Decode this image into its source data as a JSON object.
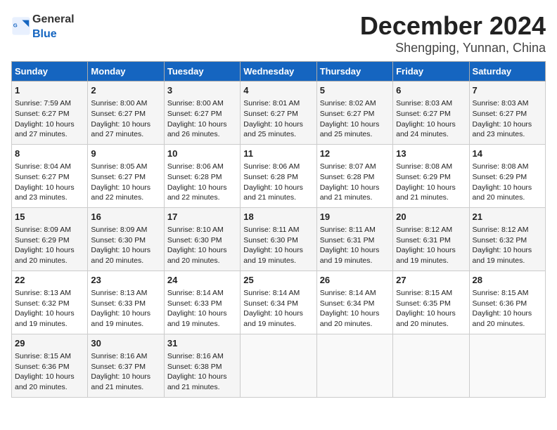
{
  "logo": {
    "general": "General",
    "blue": "Blue"
  },
  "title": "December 2024",
  "subtitle": "Shengping, Yunnan, China",
  "days_header": [
    "Sunday",
    "Monday",
    "Tuesday",
    "Wednesday",
    "Thursday",
    "Friday",
    "Saturday"
  ],
  "weeks": [
    [
      {
        "day": "1",
        "info": "Sunrise: 7:59 AM\nSunset: 6:27 PM\nDaylight: 10 hours\nand 27 minutes."
      },
      {
        "day": "2",
        "info": "Sunrise: 8:00 AM\nSunset: 6:27 PM\nDaylight: 10 hours\nand 27 minutes."
      },
      {
        "day": "3",
        "info": "Sunrise: 8:00 AM\nSunset: 6:27 PM\nDaylight: 10 hours\nand 26 minutes."
      },
      {
        "day": "4",
        "info": "Sunrise: 8:01 AM\nSunset: 6:27 PM\nDaylight: 10 hours\nand 25 minutes."
      },
      {
        "day": "5",
        "info": "Sunrise: 8:02 AM\nSunset: 6:27 PM\nDaylight: 10 hours\nand 25 minutes."
      },
      {
        "day": "6",
        "info": "Sunrise: 8:03 AM\nSunset: 6:27 PM\nDaylight: 10 hours\nand 24 minutes."
      },
      {
        "day": "7",
        "info": "Sunrise: 8:03 AM\nSunset: 6:27 PM\nDaylight: 10 hours\nand 23 minutes."
      }
    ],
    [
      {
        "day": "8",
        "info": "Sunrise: 8:04 AM\nSunset: 6:27 PM\nDaylight: 10 hours\nand 23 minutes."
      },
      {
        "day": "9",
        "info": "Sunrise: 8:05 AM\nSunset: 6:27 PM\nDaylight: 10 hours\nand 22 minutes."
      },
      {
        "day": "10",
        "info": "Sunrise: 8:06 AM\nSunset: 6:28 PM\nDaylight: 10 hours\nand 22 minutes."
      },
      {
        "day": "11",
        "info": "Sunrise: 8:06 AM\nSunset: 6:28 PM\nDaylight: 10 hours\nand 21 minutes."
      },
      {
        "day": "12",
        "info": "Sunrise: 8:07 AM\nSunset: 6:28 PM\nDaylight: 10 hours\nand 21 minutes."
      },
      {
        "day": "13",
        "info": "Sunrise: 8:08 AM\nSunset: 6:29 PM\nDaylight: 10 hours\nand 21 minutes."
      },
      {
        "day": "14",
        "info": "Sunrise: 8:08 AM\nSunset: 6:29 PM\nDaylight: 10 hours\nand 20 minutes."
      }
    ],
    [
      {
        "day": "15",
        "info": "Sunrise: 8:09 AM\nSunset: 6:29 PM\nDaylight: 10 hours\nand 20 minutes."
      },
      {
        "day": "16",
        "info": "Sunrise: 8:09 AM\nSunset: 6:30 PM\nDaylight: 10 hours\nand 20 minutes."
      },
      {
        "day": "17",
        "info": "Sunrise: 8:10 AM\nSunset: 6:30 PM\nDaylight: 10 hours\nand 20 minutes."
      },
      {
        "day": "18",
        "info": "Sunrise: 8:11 AM\nSunset: 6:30 PM\nDaylight: 10 hours\nand 19 minutes."
      },
      {
        "day": "19",
        "info": "Sunrise: 8:11 AM\nSunset: 6:31 PM\nDaylight: 10 hours\nand 19 minutes."
      },
      {
        "day": "20",
        "info": "Sunrise: 8:12 AM\nSunset: 6:31 PM\nDaylight: 10 hours\nand 19 minutes."
      },
      {
        "day": "21",
        "info": "Sunrise: 8:12 AM\nSunset: 6:32 PM\nDaylight: 10 hours\nand 19 minutes."
      }
    ],
    [
      {
        "day": "22",
        "info": "Sunrise: 8:13 AM\nSunset: 6:32 PM\nDaylight: 10 hours\nand 19 minutes."
      },
      {
        "day": "23",
        "info": "Sunrise: 8:13 AM\nSunset: 6:33 PM\nDaylight: 10 hours\nand 19 minutes."
      },
      {
        "day": "24",
        "info": "Sunrise: 8:14 AM\nSunset: 6:33 PM\nDaylight: 10 hours\nand 19 minutes."
      },
      {
        "day": "25",
        "info": "Sunrise: 8:14 AM\nSunset: 6:34 PM\nDaylight: 10 hours\nand 19 minutes."
      },
      {
        "day": "26",
        "info": "Sunrise: 8:14 AM\nSunset: 6:34 PM\nDaylight: 10 hours\nand 20 minutes."
      },
      {
        "day": "27",
        "info": "Sunrise: 8:15 AM\nSunset: 6:35 PM\nDaylight: 10 hours\nand 20 minutes."
      },
      {
        "day": "28",
        "info": "Sunrise: 8:15 AM\nSunset: 6:36 PM\nDaylight: 10 hours\nand 20 minutes."
      }
    ],
    [
      {
        "day": "29",
        "info": "Sunrise: 8:15 AM\nSunset: 6:36 PM\nDaylight: 10 hours\nand 20 minutes."
      },
      {
        "day": "30",
        "info": "Sunrise: 8:16 AM\nSunset: 6:37 PM\nDaylight: 10 hours\nand 21 minutes."
      },
      {
        "day": "31",
        "info": "Sunrise: 8:16 AM\nSunset: 6:38 PM\nDaylight: 10 hours\nand 21 minutes."
      },
      {
        "day": "",
        "info": ""
      },
      {
        "day": "",
        "info": ""
      },
      {
        "day": "",
        "info": ""
      },
      {
        "day": "",
        "info": ""
      }
    ]
  ]
}
